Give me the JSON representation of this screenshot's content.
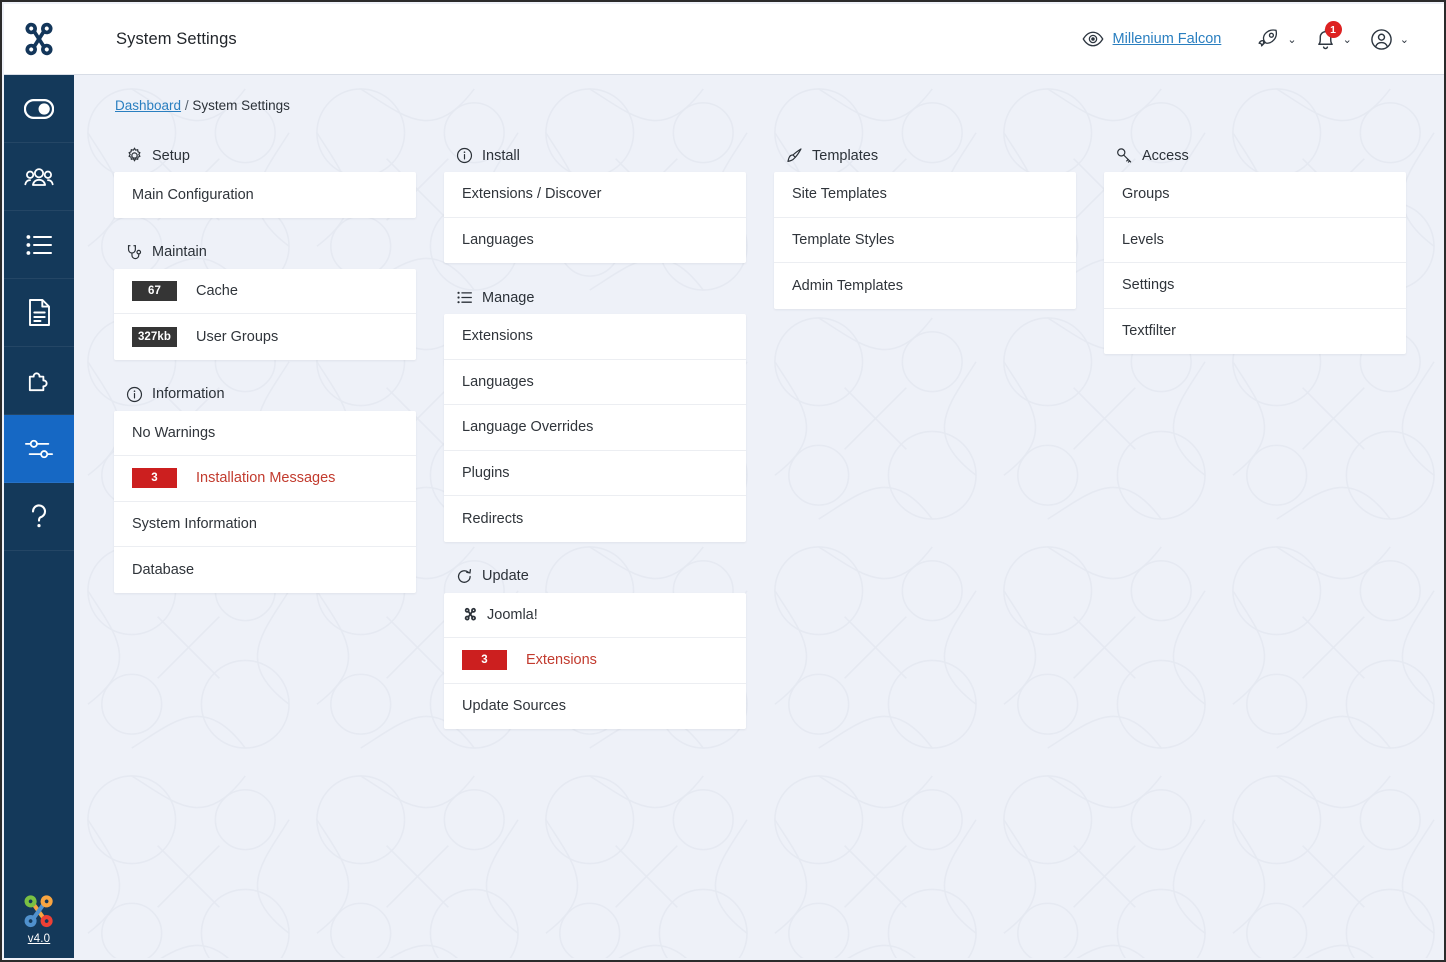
{
  "header": {
    "title": "System Settings",
    "brand_icon": "joomla-logo-icon",
    "preview_icon": "eye-icon",
    "site_name": "Millenium Falcon",
    "rocket_icon": "rocket-icon",
    "notifications_icon": "bell-icon",
    "notifications_count": "1",
    "user_icon": "user-circle-icon",
    "chevron": "⌄"
  },
  "sidebar": {
    "items": [
      {
        "icon": "toggle-switch-icon",
        "name": "sidebar-item-toggle",
        "active": false
      },
      {
        "icon": "users-icon",
        "name": "sidebar-item-users",
        "active": false
      },
      {
        "icon": "list-icon",
        "name": "sidebar-item-content",
        "active": false
      },
      {
        "icon": "document-icon",
        "name": "sidebar-item-documents",
        "active": false
      },
      {
        "icon": "puzzle-icon",
        "name": "sidebar-item-extensions",
        "active": false
      },
      {
        "icon": "sliders-icon",
        "name": "sidebar-item-system",
        "active": true
      },
      {
        "icon": "question-mark-icon",
        "name": "sidebar-item-help",
        "active": false
      }
    ],
    "version_label": "v4.0",
    "version_icon": "joomla-color-logo-icon"
  },
  "breadcrumb": {
    "home": "Dashboard",
    "separator": "/",
    "current": "System Settings"
  },
  "columns": [
    {
      "groups": [
        {
          "title": "Setup",
          "icon": "gear-icon",
          "rows": [
            {
              "label": "Main Configuration"
            }
          ]
        },
        {
          "title": "Maintain",
          "icon": "stethoscope-icon",
          "rows": [
            {
              "label": "Cache",
              "badge": "67"
            },
            {
              "label": "User Groups",
              "badge": "327kb"
            }
          ]
        },
        {
          "title": "Information",
          "icon": "info-circle-icon",
          "rows": [
            {
              "label": "No Warnings"
            },
            {
              "label": "Installation Messages",
              "badge": "3",
              "danger": true
            },
            {
              "label": "System Information"
            },
            {
              "label": "Database"
            }
          ]
        }
      ]
    },
    {
      "groups": [
        {
          "title": "Install",
          "icon": "info-circle-icon",
          "rows": [
            {
              "label": "Extensions / Discover"
            },
            {
              "label": "Languages"
            }
          ]
        },
        {
          "title": "Manage",
          "icon": "list-icon",
          "rows": [
            {
              "label": "Extensions"
            },
            {
              "label": "Languages"
            },
            {
              "label": "Language Overrides"
            },
            {
              "label": "Plugins"
            },
            {
              "label": "Redirects"
            }
          ]
        },
        {
          "title": "Update",
          "icon": "refresh-icon",
          "rows": [
            {
              "label": "Joomla!",
              "icon": "joomla-logo-icon"
            },
            {
              "label": "Extensions",
              "badge": "3",
              "danger": true
            },
            {
              "label": "Update Sources"
            }
          ]
        }
      ]
    },
    {
      "groups": [
        {
          "title": "Templates",
          "icon": "paintbrush-icon",
          "rows": [
            {
              "label": "Site Templates"
            },
            {
              "label": "Template Styles"
            },
            {
              "label": "Admin Templates"
            }
          ]
        }
      ]
    },
    {
      "groups": [
        {
          "title": "Access",
          "icon": "key-icon",
          "rows": [
            {
              "label": "Groups"
            },
            {
              "label": "Levels"
            },
            {
              "label": "Settings"
            },
            {
              "label": "Textfilter"
            }
          ]
        }
      ]
    }
  ],
  "colors": {
    "sidebar": "#14395a",
    "sidebar_active": "#1668c4",
    "link": "#2a7fc0",
    "danger": "#cc1f1f",
    "badge": "#353535",
    "background": "#eef1f8"
  }
}
